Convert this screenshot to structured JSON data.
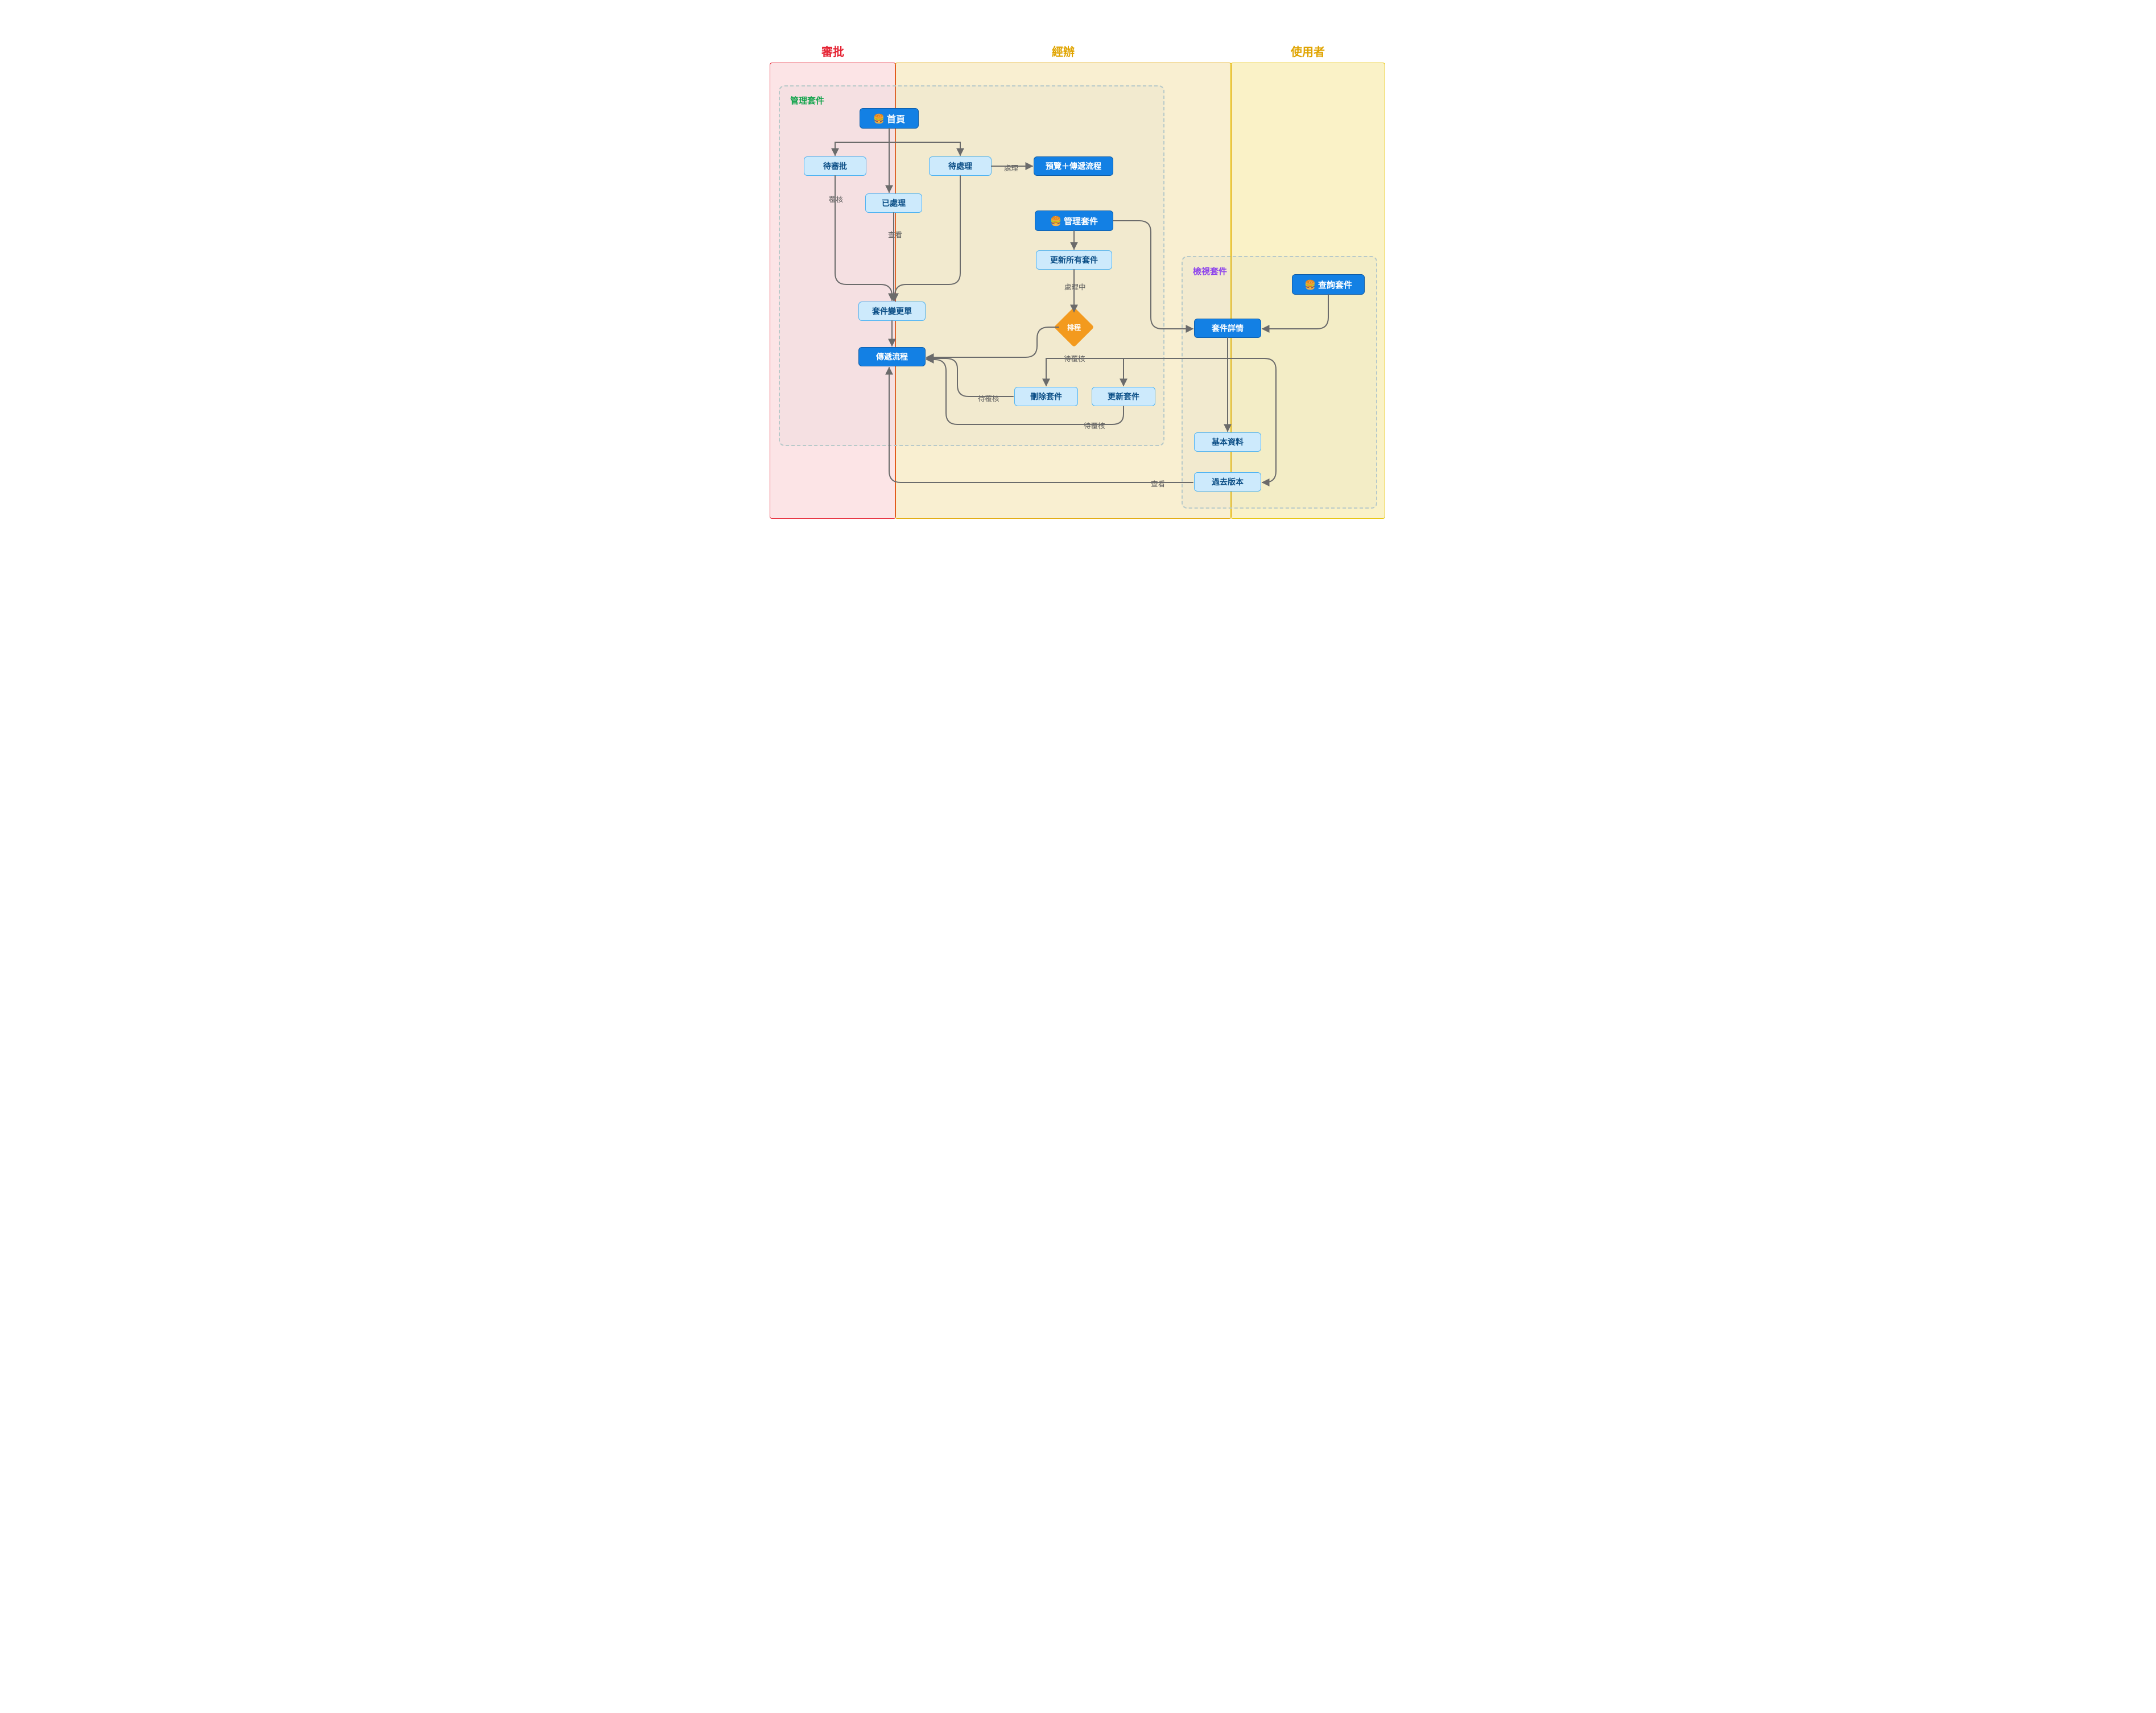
{
  "lanes": {
    "approval": {
      "label": "審批",
      "color": "#E52333",
      "fill": "rgba(229,35,51,0.12)"
    },
    "handler": {
      "label": "經辦",
      "color": "#E0A400",
      "fill": "rgba(224,164,0,0.18)"
    },
    "user": {
      "label": "使用者",
      "color": "#E6C200",
      "fill": "rgba(230,194,0,0.22)"
    }
  },
  "groups": {
    "manage": {
      "label": "管理套件",
      "labelColor": "#14A44D"
    },
    "view": {
      "label": "檢視套件",
      "labelColor": "#8E44EC"
    }
  },
  "nodes": {
    "home": {
      "label": "首頁",
      "hasIcon": true
    },
    "manage_pkg": {
      "label": "管理套件",
      "hasIcon": true
    },
    "query_pkg": {
      "label": "查詢套件",
      "hasIcon": true
    },
    "to_approve": {
      "label": "待審批"
    },
    "to_process": {
      "label": "待處理"
    },
    "processed": {
      "label": "已處理"
    },
    "preview": {
      "label": "預覽＋傳遞流程"
    },
    "update_all": {
      "label": "更新所有套件"
    },
    "change_ticket": {
      "label": "套件變更單"
    },
    "pass_flow": {
      "label": "傳遞流程"
    },
    "delete_pkg": {
      "label": "刪除套件"
    },
    "update_pkg": {
      "label": "更新套件"
    },
    "pkg_detail": {
      "label": "套件詳情"
    },
    "basic_info": {
      "label": "基本資料"
    },
    "past_versions": {
      "label": "過去版本"
    },
    "decision": {
      "label": "排程"
    }
  },
  "edgeLabels": {
    "review": "覆核",
    "view": "查看",
    "handle": "處理",
    "inprocess": "處理中",
    "pending": "待覆核"
  }
}
